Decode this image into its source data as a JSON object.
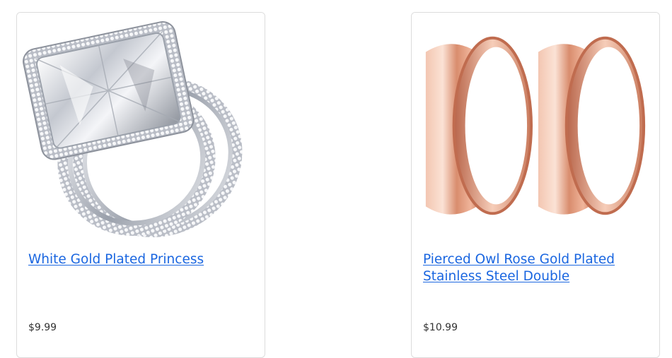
{
  "products": [
    {
      "title": "White Gold Plated Princess",
      "price": "$9.99",
      "image_icon": "diamond-ring-set-image"
    },
    {
      "title": "Pierced Owl Rose Gold Plated Stainless Steel Double",
      "price": "$10.99",
      "image_icon": "rose-gold-tunnel-plugs-image"
    }
  ],
  "colors": {
    "link": "#1a66e0",
    "price": "#333333",
    "border": "#dcdcdc",
    "rose_gold": "#e8a48a",
    "silver": "#c9ccd4"
  }
}
